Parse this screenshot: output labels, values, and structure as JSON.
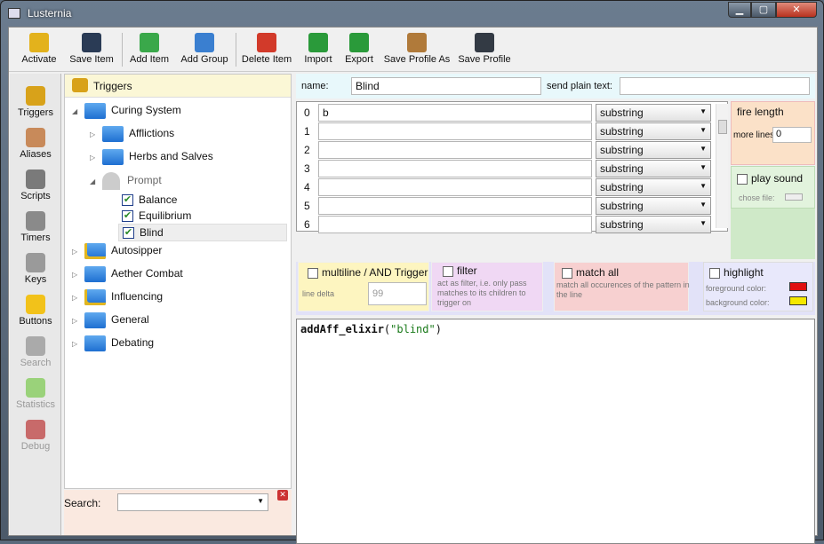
{
  "window": {
    "title": "Lusternia",
    "min": "▁",
    "max": "▢",
    "close": "✕"
  },
  "toolbar": [
    {
      "label": "Activate",
      "icon": "lock-icon",
      "color": "#e3b21c"
    },
    {
      "label": "Save Item",
      "icon": "save-item-icon",
      "color": "#2a3b55"
    },
    {
      "label": "Add Item",
      "icon": "add-item-icon",
      "color": "#3aa84a"
    },
    {
      "label": "Add Group",
      "icon": "add-group-icon",
      "color": "#3a7fd0"
    },
    {
      "label": "Delete Item",
      "icon": "delete-item-icon",
      "color": "#d23a2a"
    },
    {
      "label": "Import",
      "icon": "import-icon",
      "color": "#2a9a3a"
    },
    {
      "label": "Export",
      "icon": "export-icon",
      "color": "#2a9a3a"
    },
    {
      "label": "Save Profile As",
      "icon": "box-icon",
      "color": "#b07a3a"
    },
    {
      "label": "Save Profile",
      "icon": "disk-icon",
      "color": "#333a44"
    }
  ],
  "sidebar": [
    {
      "label": "Triggers",
      "icon": "triggers-icon",
      "color": "#d8a21a",
      "dim": false
    },
    {
      "label": "Aliases",
      "icon": "aliases-icon",
      "color": "#c88a5a",
      "dim": false
    },
    {
      "label": "Scripts",
      "icon": "scripts-icon",
      "color": "#7a7a7a",
      "dim": false
    },
    {
      "label": "Timers",
      "icon": "timers-icon",
      "color": "#8a8a8a",
      "dim": false
    },
    {
      "label": "Keys",
      "icon": "keys-icon",
      "color": "#9a9a9a",
      "dim": false
    },
    {
      "label": "Buttons",
      "icon": "star-icon",
      "color": "#f2c21a",
      "dim": false
    },
    {
      "label": "Search",
      "icon": "search-person-icon",
      "color": "#aaa",
      "dim": true
    },
    {
      "label": "Statistics",
      "icon": "statistics-icon",
      "color": "#9ad27a",
      "dim": true
    },
    {
      "label": "Debug",
      "icon": "bug-icon",
      "color": "#c86a6a",
      "dim": true
    }
  ],
  "tree": {
    "header": "Triggers",
    "nodes": [
      {
        "label": "Curing System",
        "indent": 0,
        "kind": "folder",
        "arrow": "◢"
      },
      {
        "label": "Afflictions",
        "indent": 1,
        "kind": "folder",
        "arrow": "▷"
      },
      {
        "label": "Herbs and Salves",
        "indent": 1,
        "kind": "folder",
        "arrow": "▷"
      },
      {
        "label": "Prompt",
        "indent": 1,
        "kind": "filter",
        "arrow": "◢"
      },
      {
        "label": "Balance",
        "indent": 2,
        "kind": "check",
        "arrow": ""
      },
      {
        "label": "Equilibrium",
        "indent": 2,
        "kind": "check",
        "arrow": ""
      },
      {
        "label": "Blind",
        "indent": 2,
        "kind": "check",
        "arrow": ""
      },
      {
        "label": "Autosipper",
        "indent": 0,
        "kind": "lock",
        "arrow": "▷"
      },
      {
        "label": "Aether Combat",
        "indent": 0,
        "kind": "folder",
        "arrow": "▷"
      },
      {
        "label": "Influencing",
        "indent": 0,
        "kind": "lock",
        "arrow": "▷"
      },
      {
        "label": "General",
        "indent": 0,
        "kind": "folder",
        "arrow": "▷"
      },
      {
        "label": "Debating",
        "indent": 0,
        "kind": "folder",
        "arrow": "▷"
      }
    ]
  },
  "search": {
    "label": "Search:",
    "value": ""
  },
  "editor_form": {
    "name_label": "name:",
    "name_value": "Blind",
    "plain_label": "send plain text:",
    "plain_value": ""
  },
  "patterns": [
    {
      "num": "0",
      "text": "b",
      "type": "substring"
    },
    {
      "num": "1",
      "text": "",
      "type": "substring"
    },
    {
      "num": "2",
      "text": "",
      "type": "substring"
    },
    {
      "num": "3",
      "text": "",
      "type": "substring"
    },
    {
      "num": "4",
      "text": "",
      "type": "substring"
    },
    {
      "num": "5",
      "text": "",
      "type": "substring"
    },
    {
      "num": "6",
      "text": "",
      "type": "substring"
    }
  ],
  "fire": {
    "title": "fire length",
    "more_lines": "more lines",
    "value": "0"
  },
  "sound": {
    "label": "play sound",
    "chose": "chose file:"
  },
  "options": {
    "multiline": "multiline / AND Trigger",
    "line_delta": "line delta",
    "line_delta_value": "99",
    "filter": "filter",
    "filter_hint": "act as filter, i.e. only pass matches to its children to trigger on",
    "match_all": "match all",
    "match_all_hint": "match all occurences of the pattern in the line",
    "highlight": "highlight",
    "fg": "foreground color:",
    "bg": "background color:",
    "fg_color": "#e01010",
    "bg_color": "#f5e800"
  },
  "code": {
    "func": "addAff_elixir",
    "arg": "\"blind\""
  }
}
